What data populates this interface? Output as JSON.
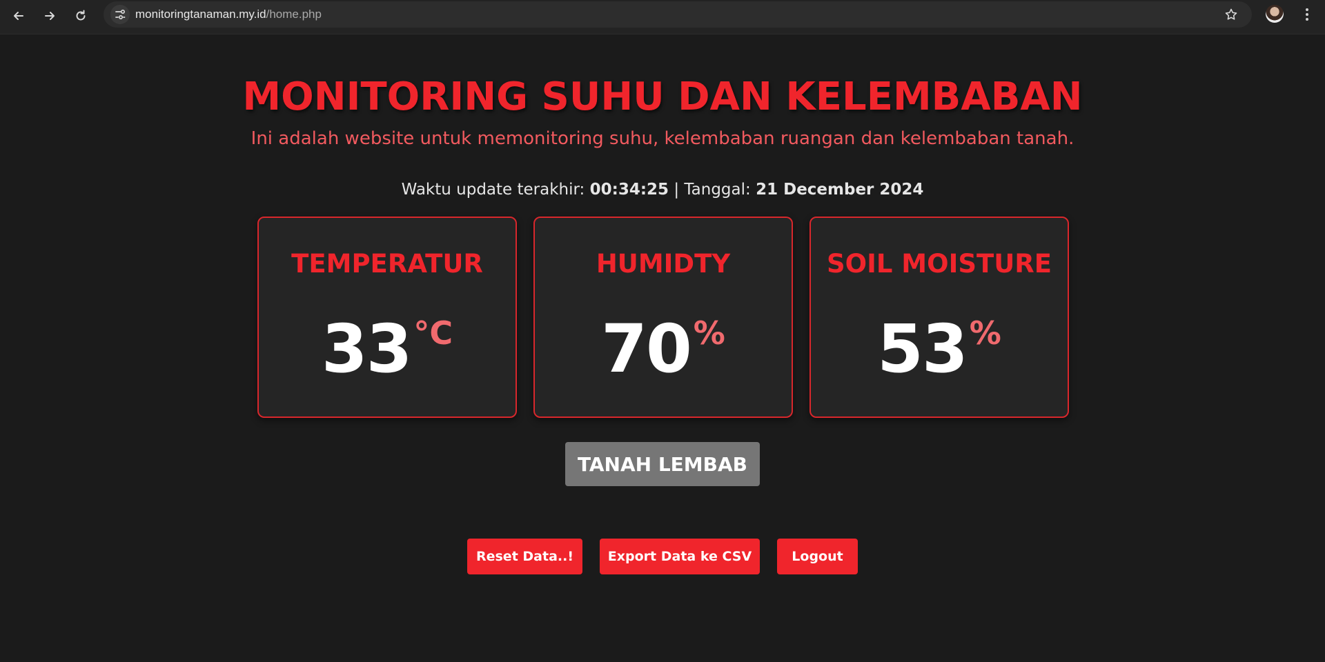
{
  "browser": {
    "url_host": "monitoringtanaman.my.id",
    "url_path": "/home.php"
  },
  "page": {
    "title": "MONITORING SUHU DAN KELEMBABAN",
    "subtitle": "Ini adalah website untuk memonitoring suhu, kelembaban ruangan dan kelembaban tanah.",
    "update_label": "Waktu update terakhir:",
    "update_time": "00:34:25",
    "separator": "|",
    "date_label": "Tanggal:",
    "date_value": "21 December 2024"
  },
  "cards": [
    {
      "title": "TEMPERATUR",
      "value": "33",
      "unit": "°C"
    },
    {
      "title": "HUMIDTY",
      "value": "70",
      "unit": "%"
    },
    {
      "title": "SOIL MOISTURE",
      "value": "53",
      "unit": "%"
    }
  ],
  "status": {
    "label": "TANAH LEMBAB"
  },
  "actions": {
    "reset": "Reset Data..!",
    "export": "Export Data ke CSV",
    "logout": "Logout"
  },
  "colors": {
    "accent": "#f0252c",
    "background": "#1b1b1b",
    "card_bg": "#252525",
    "status_bg": "#767676"
  }
}
